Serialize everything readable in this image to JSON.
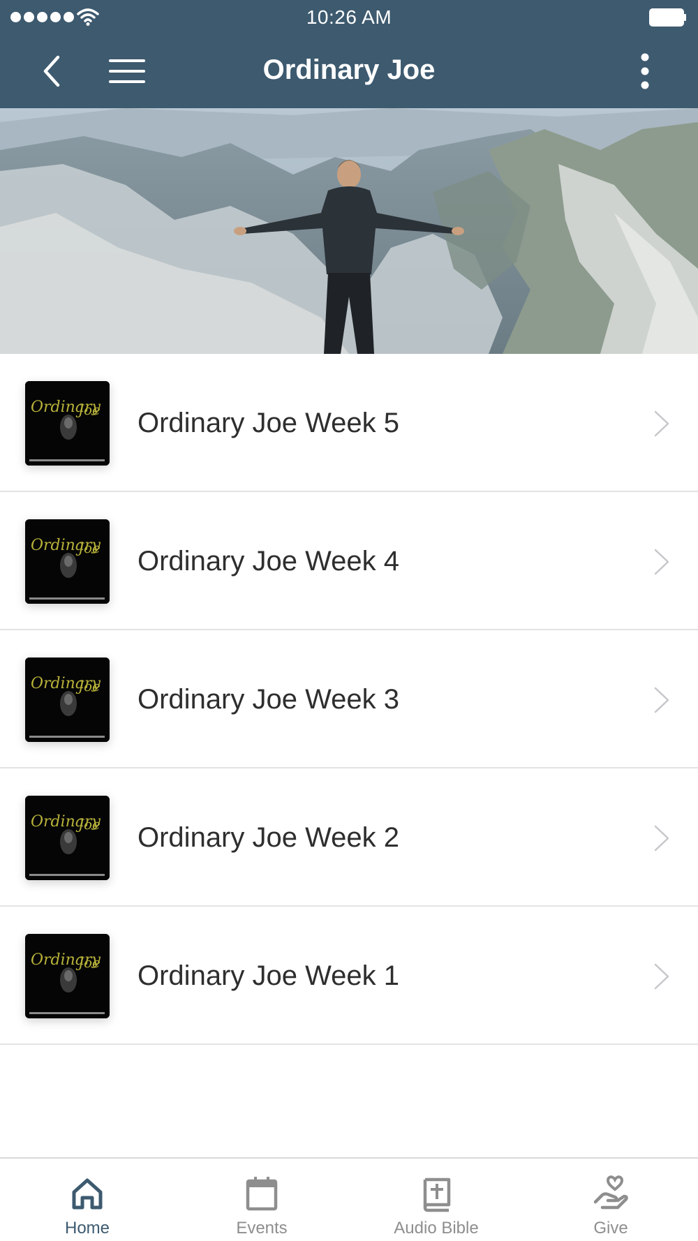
{
  "status_bar": {
    "time": "10:26 AM"
  },
  "nav": {
    "title": "Ordinary Joe"
  },
  "colors": {
    "nav_bg": "#3d5a6f",
    "active_tab": "#3d5a6f",
    "inactive_tab": "#8e8e8e"
  },
  "items": [
    {
      "label": "Ordinary Joe Week 5"
    },
    {
      "label": "Ordinary Joe Week 4"
    },
    {
      "label": "Ordinary Joe Week 3"
    },
    {
      "label": "Ordinary Joe Week 2"
    },
    {
      "label": "Ordinary Joe Week 1"
    }
  ],
  "tabs": [
    {
      "label": "Home",
      "icon": "home-icon",
      "active": true
    },
    {
      "label": "Events",
      "icon": "calendar-icon",
      "active": false
    },
    {
      "label": "Audio Bible",
      "icon": "bible-icon",
      "active": false
    },
    {
      "label": "Give",
      "icon": "give-icon",
      "active": false
    }
  ]
}
